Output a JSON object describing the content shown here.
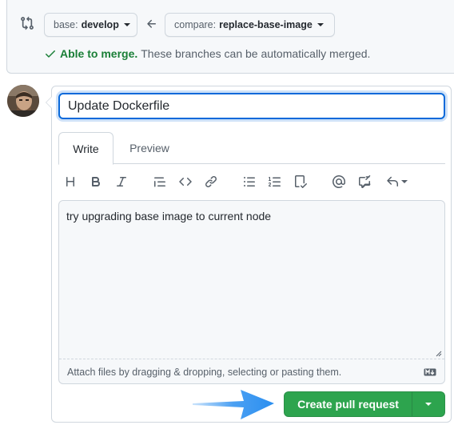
{
  "branch_bar": {
    "base_label": "base:",
    "base_value": "develop",
    "compare_label": "compare:",
    "compare_value": "replace-base-image",
    "merge_ok": "Able to merge.",
    "merge_text": "These branches can be automatically merged."
  },
  "form": {
    "title_value": "Update Dockerfile",
    "tabs": [
      {
        "label": "Write",
        "active": true
      },
      {
        "label": "Preview",
        "active": false
      }
    ],
    "toolbar_icons": [
      "heading-icon",
      "bold-icon",
      "italic-icon",
      "quote-icon",
      "code-icon",
      "link-icon",
      "unordered-list-icon",
      "ordered-list-icon",
      "task-list-icon",
      "mention-icon",
      "cross-reference-icon",
      "saved-reply-icon"
    ],
    "body_value": "try upgrading base image to current node",
    "attach_text": "Attach files by dragging & dropping, selecting or pasting them.",
    "submit_label": "Create pull request"
  },
  "colors": {
    "accent_blue": "#0969da",
    "success_green": "#2da44e",
    "merge_green": "#1a7f37",
    "annotation_arrow": "#2b8ff0"
  }
}
